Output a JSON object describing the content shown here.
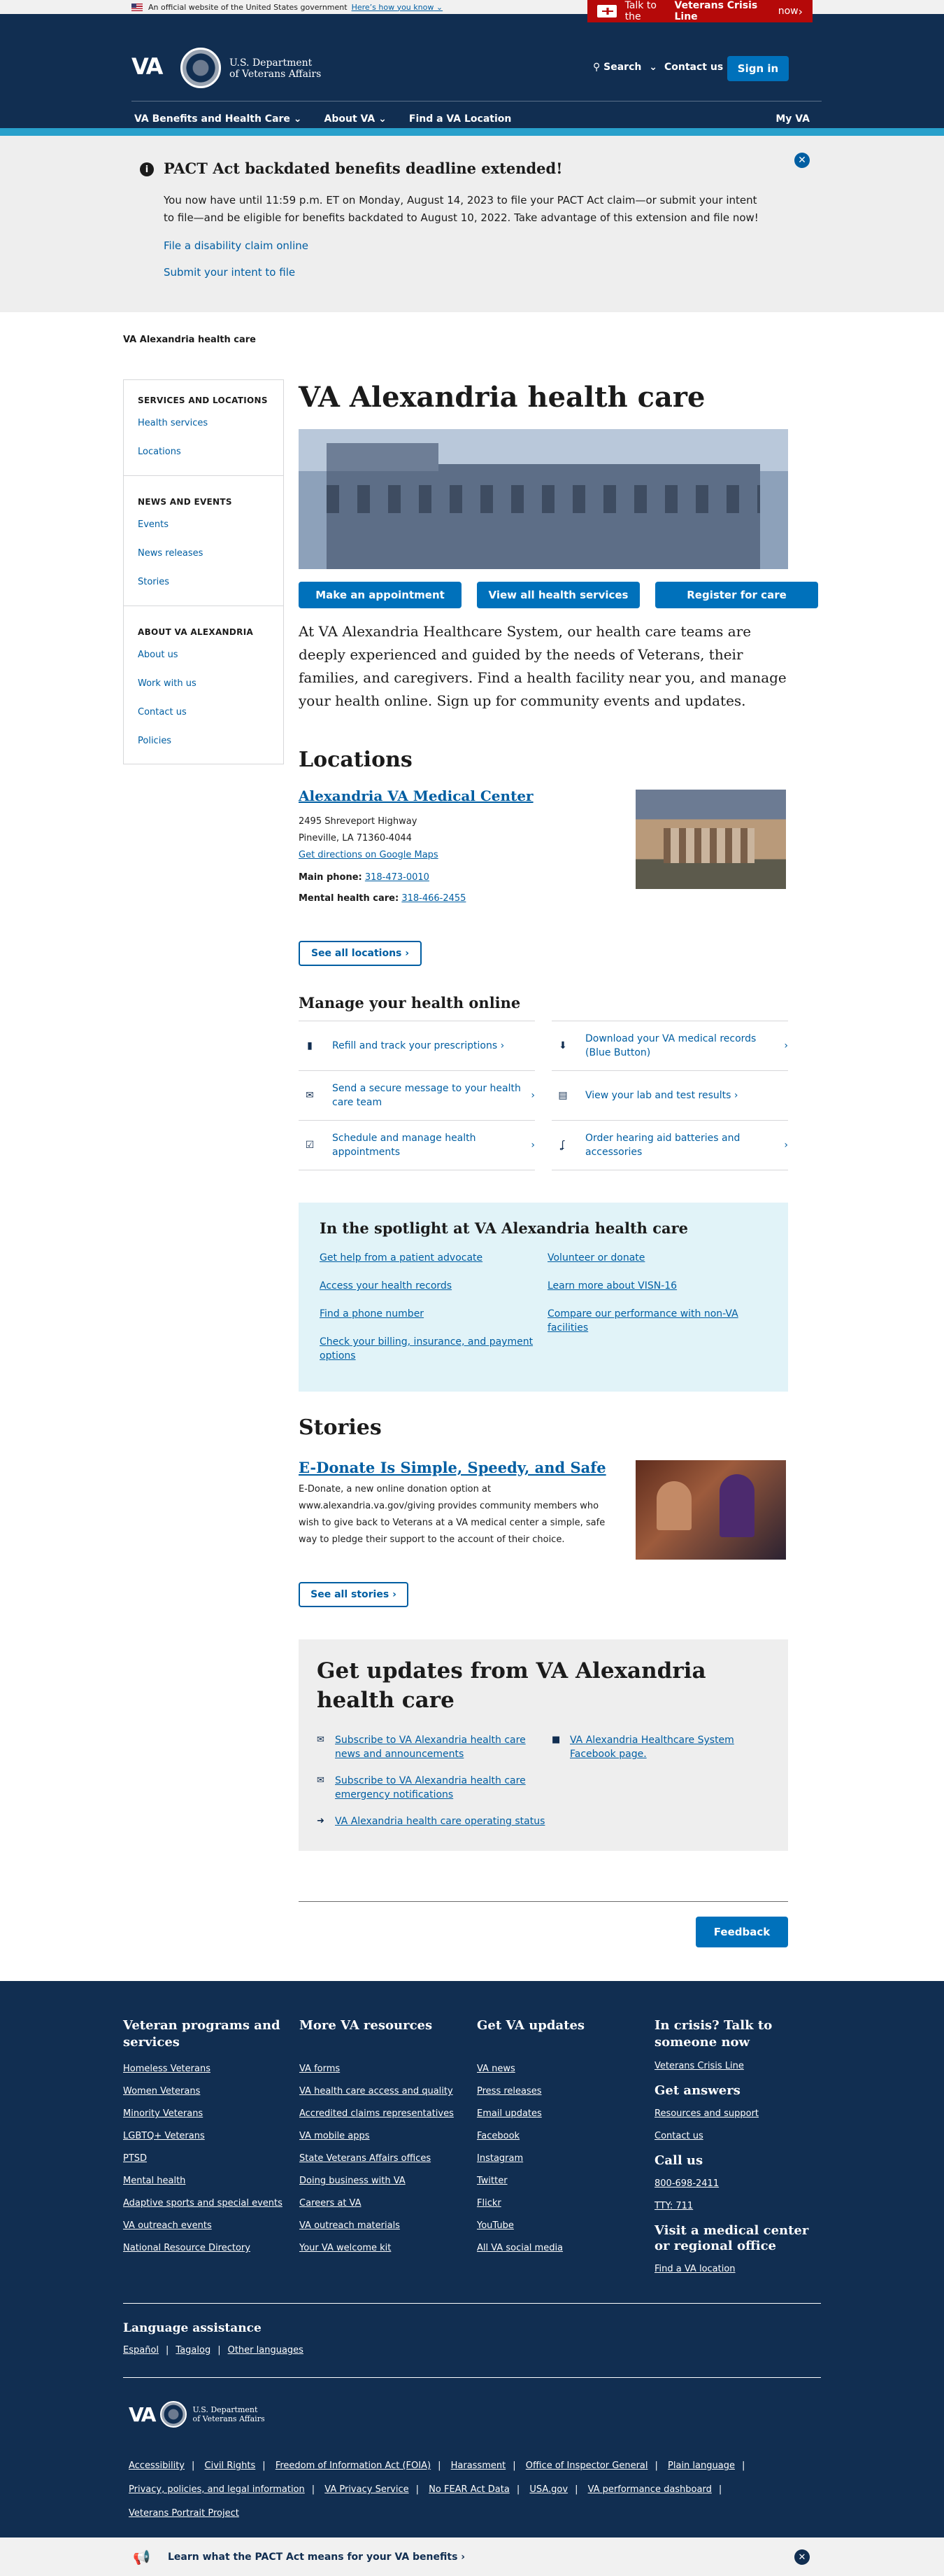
{
  "gov_banner": {
    "text": "An official website of the United States government",
    "link": "Here’s how you know"
  },
  "crisis": {
    "prefix": "Talk to the",
    "bold": "Veterans Crisis Line",
    "suffix": "now"
  },
  "header": {
    "logo": "VA",
    "dept_line1": "U.S. Department",
    "dept_line2": "of Veterans Affairs",
    "search": "Search",
    "contact": "Contact us",
    "signin": "Sign in",
    "nav": [
      "VA Benefits and Health Care",
      "About VA",
      "Find a VA Location"
    ],
    "myva": "My VA"
  },
  "alert": {
    "title": "PACT Act backdated benefits deadline extended!",
    "body": "You now have until 11:59 p.m. ET on Monday, August 14, 2023 to file your PACT Act claim—or submit your intent to file—and be eligible for benefits backdated to August 10, 2022. Take advantage of this extension and file now!",
    "link1": "File a disability claim online",
    "link2": "Submit your intent to file"
  },
  "breadcrumb": "VA Alexandria health care",
  "sidebar": {
    "sections": [
      {
        "heading": "SERVICES AND LOCATIONS",
        "items": [
          "Health services",
          "Locations"
        ]
      },
      {
        "heading": "NEWS AND EVENTS",
        "items": [
          "Events",
          "News releases",
          "Stories"
        ]
      },
      {
        "heading": "ABOUT VA ALEXANDRIA",
        "items": [
          "About us",
          "Work with us",
          "Contact us",
          "Policies"
        ]
      }
    ]
  },
  "main": {
    "title": "VA Alexandria health care",
    "ctas": [
      "Make an appointment",
      "View all health services",
      "Register for care"
    ],
    "intro": "At VA Alexandria Healthcare System, our health care teams are deeply experienced and guided by the needs of Veterans, their families, and caregivers. Find a health facility near you, and manage your health online. Sign up for community events and updates.",
    "locations": {
      "heading": "Locations",
      "facility": "Alexandria VA Medical Center",
      "address1": "2495 Shreveport Highway",
      "address2": "Pineville, LA 71360-4044",
      "directions": "Get directions on Google Maps",
      "main_phone_label": "Main phone:",
      "main_phone": "318-473-0010",
      "mental_label": "Mental health care:",
      "mental_phone": "318-466-2455",
      "see_all": "See all locations"
    },
    "manage": {
      "heading": "Manage your health online",
      "items": [
        {
          "icon": "pill-bottle-icon",
          "label": "Refill and track your prescriptions"
        },
        {
          "icon": "file-download-icon",
          "label": "Download your VA medical records (Blue Button)"
        },
        {
          "icon": "message-icon",
          "label": "Send a secure message to your health care team"
        },
        {
          "icon": "clipboard-icon",
          "label": "View your lab and test results"
        },
        {
          "icon": "calendar-check-icon",
          "label": "Schedule and manage health appointments"
        },
        {
          "icon": "hearing-aid-icon",
          "label": "Order hearing aid batteries and accessories"
        }
      ]
    },
    "spotlight": {
      "heading": "In the spotlight at VA Alexandria health care",
      "left": [
        "Get help from a patient advocate",
        "Access your health records",
        "Find a phone number",
        "Check your billing, insurance, and payment options"
      ],
      "right": [
        "Volunteer or donate",
        "Learn more about VISN-16",
        "Compare our performance with non-VA facilities"
      ]
    },
    "stories": {
      "heading": "Stories",
      "title": "E-Donate Is Simple, Speedy, and Safe",
      "body": "E-Donate, a new online donation option at www.alexandria.va.gov/giving provides community members who wish to give back to Veterans at a VA medical center a simple, safe way to pledge their support to the account of their choice.",
      "see_all": "See all stories"
    },
    "updates": {
      "heading": "Get updates from VA Alexandria health care",
      "left": [
        {
          "icon": "envelope-icon",
          "label": "Subscribe to VA Alexandria health care news and announcements"
        },
        {
          "icon": "envelope-icon",
          "label": "Subscribe to VA Alexandria health care emergency notifications"
        },
        {
          "icon": "info-circle-icon",
          "label": "VA Alexandria health care operating status"
        }
      ],
      "right": [
        {
          "icon": "facebook-icon",
          "label": "VA Alexandria Healthcare System Facebook page."
        }
      ]
    },
    "feedback": "Feedback"
  },
  "footer": {
    "col1": {
      "heading": "Veteran programs and services",
      "links": [
        "Homeless Veterans",
        "Women Veterans",
        "Minority Veterans",
        "LGBTQ+ Veterans",
        "PTSD",
        "Mental health",
        "Adaptive sports and special events",
        "VA outreach events",
        "National Resource Directory"
      ]
    },
    "col2": {
      "heading": "More VA resources",
      "links": [
        "VA forms",
        "VA health care access and quality",
        "Accredited claims representatives",
        "VA mobile apps",
        "State Veterans Affairs offices",
        "Doing business with VA",
        "Careers at VA",
        "VA outreach materials",
        "Your VA welcome kit"
      ]
    },
    "col3": {
      "heading": "Get VA updates",
      "links": [
        "VA news",
        "Press releases",
        "Email updates",
        "Facebook",
        "Instagram",
        "Twitter",
        "Flickr",
        "YouTube",
        "All VA social media"
      ]
    },
    "col4": {
      "heading": "In crisis? Talk to someone now",
      "crisis_link": "Veterans Crisis Line",
      "answers_heading": "Get answers",
      "answers": [
        "Resources and support",
        "Contact us"
      ],
      "call_heading": "Call us",
      "phones": [
        "800-698-2411",
        "TTY: 711"
      ],
      "visit_heading": "Visit a medical center or regional office",
      "visit_link": "Find a VA location"
    },
    "language": {
      "heading": "Language assistance",
      "links": [
        "Español",
        "Tagalog",
        "Other languages"
      ]
    },
    "legal_row1": [
      "Accessibility",
      "Civil Rights",
      "Freedom of Information Act (FOIA)",
      "Harassment",
      "Office of Inspector General",
      "Plain language"
    ],
    "legal_row2": [
      "Privacy, policies, and legal information",
      "VA Privacy Service",
      "No FEAR Act Data",
      "USA.gov",
      "VA performance dashboard"
    ],
    "legal_row3": [
      "Veterans Portrait Project"
    ],
    "pact": "Learn what the PACT Act means for your VA benefits"
  },
  "colors": {
    "primary": "#005ea2",
    "navy": "#112e51",
    "crisis_red": "#b50909",
    "spotlight": "#e1f3f8"
  }
}
